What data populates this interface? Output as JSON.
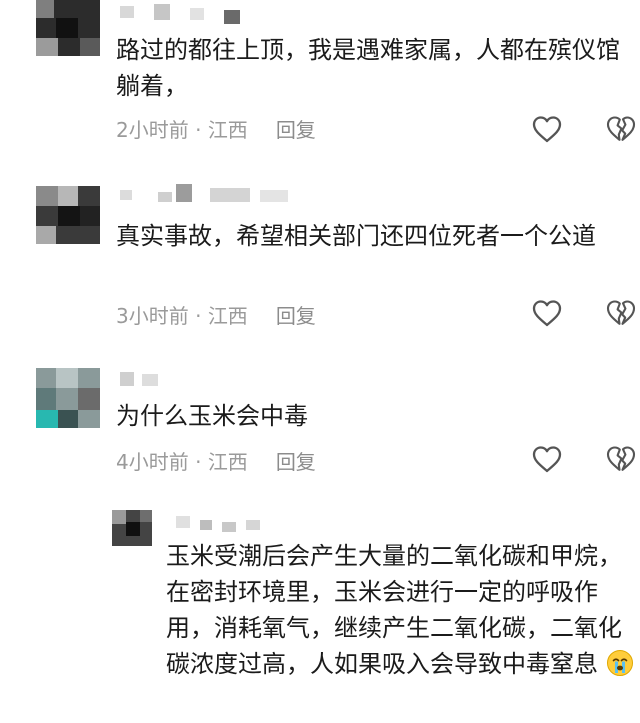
{
  "comments": [
    {
      "text": "路过的都往上顶，我是遇难家属，人都在殡仪馆躺着，",
      "time": "2小时前",
      "sep": " · ",
      "location": "江西",
      "reply": "回复",
      "like_icon": "heart-outline-icon",
      "dislike_icon": "broken-heart-icon"
    },
    {
      "text": "真实事故，希望相关部门还四位死者一个公道",
      "time": "3小时前",
      "sep": " · ",
      "location": "江西",
      "reply": "回复",
      "like_icon": "heart-outline-icon",
      "dislike_icon": "broken-heart-icon"
    },
    {
      "text": "为什么玉米会中毒",
      "time": "4小时前",
      "sep": " · ",
      "location": "江西",
      "reply": "回复",
      "like_icon": "heart-outline-icon",
      "dislike_icon": "broken-heart-icon"
    }
  ],
  "nested_reply": {
    "text": "玉米受潮后会产生大量的二氧化碳和甲烷，在密封环境里，玉米会进行一定的呼吸作用，消耗氧气，继续产生二氧化碳，二氧化碳浓度过高，人如果吸入会导致中毒窒息",
    "emoji": "crying-face-emoji"
  },
  "colors": {
    "text": "#1b1b1b",
    "meta": "#9a9a9a",
    "icon": "#555555",
    "background": "#ffffff"
  }
}
